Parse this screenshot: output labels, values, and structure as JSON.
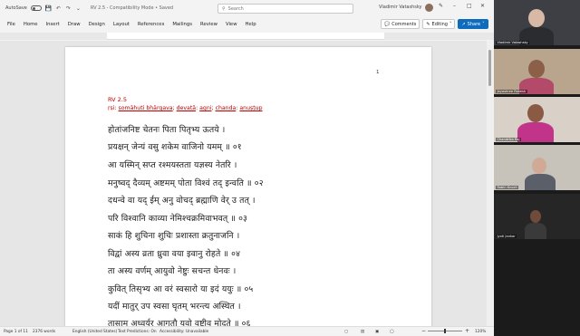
{
  "titlebar": {
    "autosave_label": "AutoSave",
    "doc_title": "RV 2.5  -  Compatibility Mode  •  Saved",
    "search_placeholder": "Search",
    "user_name": "Vladimir Vatashsky",
    "minimize": "–",
    "maximize": "□",
    "close": "✕"
  },
  "menu": {
    "items": [
      "File",
      "Home",
      "Insert",
      "Draw",
      "Design",
      "Layout",
      "References",
      "Mailings",
      "Review",
      "View",
      "Help"
    ]
  },
  "ribbon_buttons": {
    "comments": "Comments",
    "editing": "Editing",
    "share": "Share"
  },
  "document": {
    "page_number": "1",
    "heading": "RV 2.5",
    "rsi_line": {
      "prefix": "ṛṣi: ",
      "rsi": "somāhuti bhārgava",
      "sep1": "; ",
      "devata_label": "devatā",
      "sep2": ": ",
      "devata": "agni",
      "sep3": "; ",
      "chanda_label": "chanda",
      "sep4": ": ",
      "chanda": "anuṣṭup"
    },
    "verses": [
      "होतांजनिष्ट चेतनः पिता पितृभ्य ऊतये ।",
      "प्रयक्षन् जेन्यं वसु शकेम वाजिनो यमम् ॥ ०१",
      "आ यस्मिन् सप्त रश्मयस्तता यज्ञस्य नेतरि ।",
      "मनुष्वद् दैव्यम् अष्टमम् पोता विश्वं तद् इन्वति ॥ ०२",
      "दधन्वे वा यद् ईम् अनु वोचद् ब्रह्माणि वेर् उ तत् ।",
      "परि विश्वानि काव्या नेमिश्चक्रमिवाभवत् ॥ ०३",
      "साकं हि शुचिना शुचिः प्रशास्ता क्रतुनाजनि ।",
      "विद्वां अस्य व्रता ध्रुवा वया इवानु रोहते ॥ ०४",
      "ता अस्य वर्णम् आयुवो नेष्टुः सचन्त धेनवः ।",
      "कुवित् तिसृभ्य आ वरं स्वसारो या इदं ययुः ॥ ०५",
      "यदीं मातुर् उप स्वसा घृतम् भरन्त्य अस्थित ।",
      "तासाम् अध्वर्युर् आगतौ यवो वृष्टीव मोदते ॥ ०६"
    ]
  },
  "status": {
    "page": "Page 1 of 11",
    "words": "2376 words",
    "language": "English (United States)",
    "predictions": "Text Predictions: On",
    "accessibility": "Accessibility: Unavailable",
    "zoom": "120%"
  },
  "participants": [
    {
      "name": "Vladimir Vatashsky"
    },
    {
      "name": "Jayashree Rakesh"
    },
    {
      "name": "Chandrika Raj"
    },
    {
      "name": "Robin Knoch"
    },
    {
      "name": "Jyoti Jankar"
    }
  ]
}
